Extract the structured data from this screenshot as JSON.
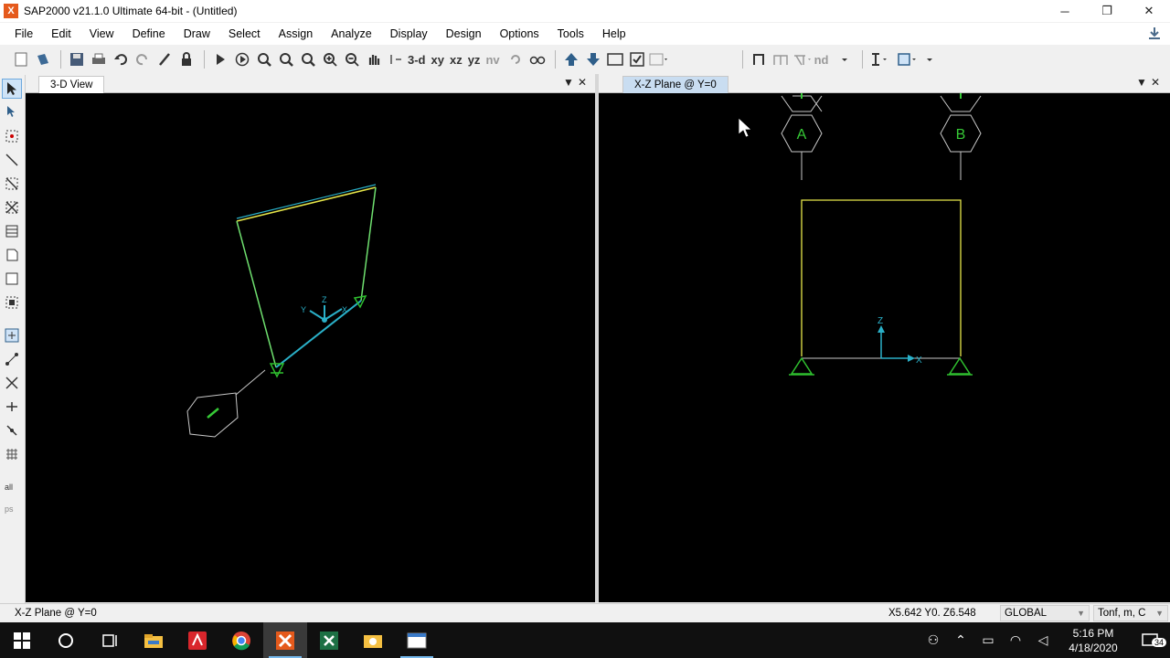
{
  "window": {
    "title": "SAP2000 v21.1.0 Ultimate 64-bit - (Untitled)",
    "app_icon_glyph": "X",
    "controls": {
      "minimize": "─",
      "restore": "❐",
      "close": "✕"
    }
  },
  "menu": [
    "File",
    "Edit",
    "View",
    "Define",
    "Draw",
    "Select",
    "Assign",
    "Analyze",
    "Display",
    "Design",
    "Options",
    "Tools",
    "Help"
  ],
  "toolbar": {
    "view_3d": "3-d",
    "view_xy": "xy",
    "view_xz": "xz",
    "view_yz": "yz",
    "view_nv": "nv",
    "nd_label": "nd"
  },
  "left_pane": {
    "tab_label": "3-D View",
    "axis_labels": {
      "z": "Z",
      "y": "Y",
      "x": "X"
    }
  },
  "right_pane": {
    "tab_label": "X-Z Plane @ Y=0",
    "grid_bubbles": [
      "A",
      "B"
    ],
    "axis_labels": {
      "z": "Z",
      "x": "X"
    }
  },
  "statusbar": {
    "view_label": "X-Z Plane @ Y=0",
    "coords": "X5.642  Y0.  Z6.548",
    "coord_system": "GLOBAL",
    "units": "Tonf, m, C"
  },
  "taskbar": {
    "time": "5:16 PM",
    "date": "4/18/2020",
    "notification_count": "34"
  },
  "colors": {
    "frame_member": "#e6e64a",
    "support": "#2fbf2f",
    "axis": "#2ab0c8",
    "grid_line": "#c8c8c8",
    "bubble_text": "#36c936"
  }
}
